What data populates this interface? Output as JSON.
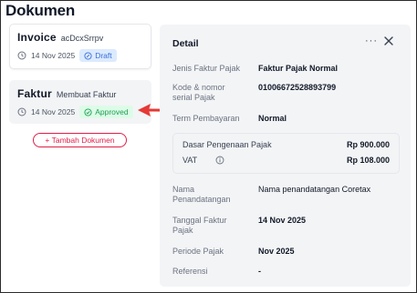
{
  "page": {
    "title": "Dokumen"
  },
  "documents": [
    {
      "name": "Invoice",
      "subtitle": "acDcxSrrpv",
      "date": "14 Nov 2025",
      "status": "Draft"
    },
    {
      "name": "Faktur",
      "subtitle": "Membuat Faktur",
      "date": "14 Nov 2025",
      "status": "Approved"
    }
  ],
  "add_button": {
    "icon": "plus-icon",
    "label": "+ Tambah Dokumen"
  },
  "detail": {
    "title": "Detail",
    "more_label": "···",
    "fields": {
      "jenis_label": "Jenis Faktur Pajak",
      "jenis_value": "Faktur Pajak Normal",
      "kode_label": "Kode & nomor serial Pajak",
      "kode_value": "01006672528893799",
      "term_label": "Term Pembayaran",
      "term_value": "Normal",
      "dpp_label": "Dasar Pengenaan Pajak",
      "dpp_value": "Rp 900.000",
      "vat_label": "VAT",
      "vat_value": "Rp 108.000",
      "nama_label": "Nama Penandatangan",
      "nama_value": "Nama penandatangan Coretax",
      "tanggal_label": "Tanggal Faktur Pajak",
      "tanggal_value": "14 Nov 2025",
      "periode_label": "Periode Pajak",
      "periode_value": "Nov 2025",
      "referensi_label": "Referensi",
      "referensi_value": "-"
    }
  },
  "colors": {
    "accent": "#e11d48",
    "draft": "#3b6fd6",
    "approved": "#1f9d55",
    "arrow": "#e53935"
  }
}
